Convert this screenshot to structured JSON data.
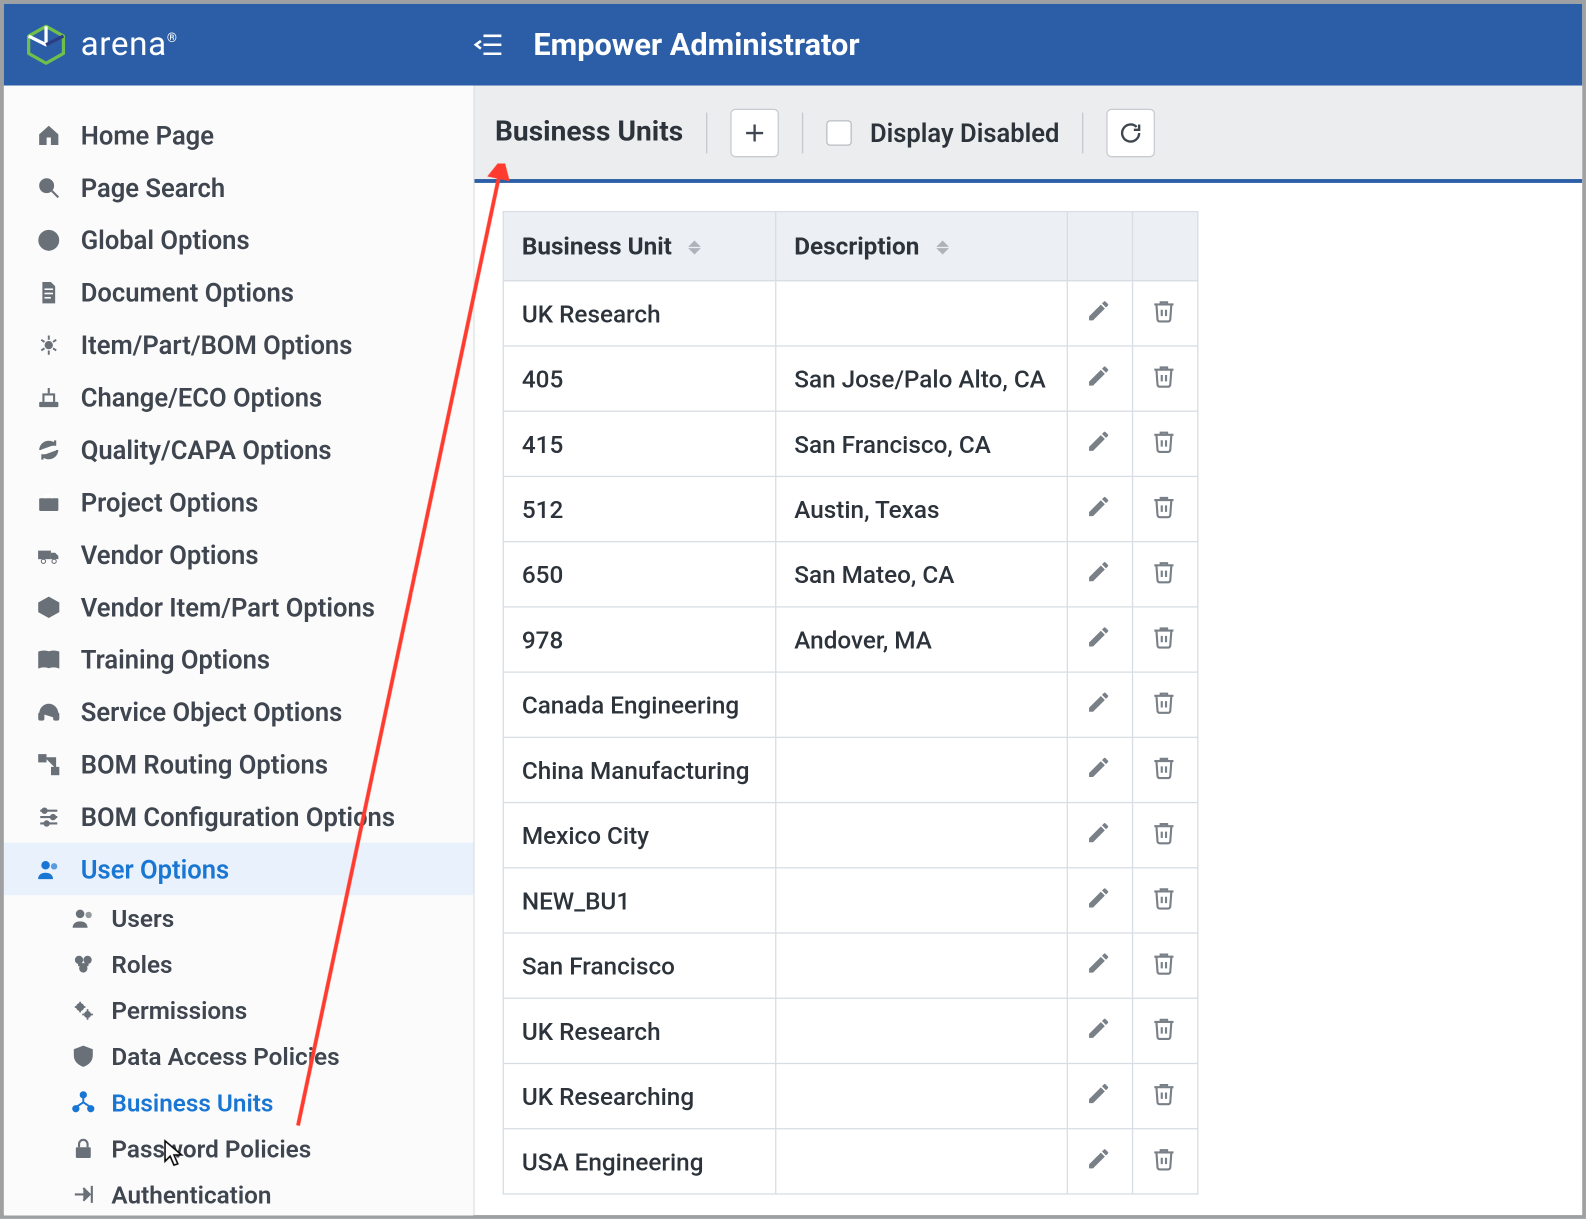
{
  "brand": {
    "name": "arena"
  },
  "header": {
    "title": "Empower Administrator"
  },
  "toolbar": {
    "page_title": "Business Units",
    "display_disabled_label": "Display Disabled"
  },
  "sidebar": {
    "items": [
      {
        "label": "Home Page",
        "icon": "home"
      },
      {
        "label": "Page Search",
        "icon": "search"
      },
      {
        "label": "Global Options",
        "icon": "globe"
      },
      {
        "label": "Document Options",
        "icon": "document"
      },
      {
        "label": "Item/Part/BOM Options",
        "icon": "part"
      },
      {
        "label": "Change/ECO Options",
        "icon": "change"
      },
      {
        "label": "Quality/CAPA Options",
        "icon": "refresh-cycle"
      },
      {
        "label": "Project Options",
        "icon": "briefcase"
      },
      {
        "label": "Vendor Options",
        "icon": "truck"
      },
      {
        "label": "Vendor Item/Part Options",
        "icon": "package"
      },
      {
        "label": "Training Options",
        "icon": "book"
      },
      {
        "label": "Service Object Options",
        "icon": "headset"
      },
      {
        "label": "BOM Routing Options",
        "icon": "routing"
      },
      {
        "label": "BOM Configuration Options",
        "icon": "config"
      },
      {
        "label": "User Options",
        "icon": "users",
        "active": true
      }
    ],
    "sub_items": [
      {
        "label": "Users",
        "icon": "users"
      },
      {
        "label": "Roles",
        "icon": "roles"
      },
      {
        "label": "Permissions",
        "icon": "gears"
      },
      {
        "label": "Data Access Policies",
        "icon": "shield"
      },
      {
        "label": "Business Units",
        "icon": "org",
        "active": true
      },
      {
        "label": "Password Policies",
        "icon": "lock"
      },
      {
        "label": "Authentication",
        "icon": "auth"
      }
    ]
  },
  "table": {
    "columns": [
      "Business Unit",
      "Description"
    ],
    "rows": [
      {
        "name": "UK Research",
        "desc": ""
      },
      {
        "name": "405",
        "desc": "San Jose/Palo Alto, CA"
      },
      {
        "name": "415",
        "desc": "San Francisco, CA"
      },
      {
        "name": "512",
        "desc": "Austin, Texas"
      },
      {
        "name": "650",
        "desc": "San Mateo, CA"
      },
      {
        "name": "978",
        "desc": "Andover, MA"
      },
      {
        "name": "Canada Engineering",
        "desc": ""
      },
      {
        "name": "China Manufacturing",
        "desc": ""
      },
      {
        "name": "Mexico City",
        "desc": ""
      },
      {
        "name": "NEW_BU1",
        "desc": ""
      },
      {
        "name": "San Francisco",
        "desc": ""
      },
      {
        "name": "UK Research",
        "desc": ""
      },
      {
        "name": "UK Researching",
        "desc": ""
      },
      {
        "name": "USA Engineering",
        "desc": ""
      }
    ]
  }
}
